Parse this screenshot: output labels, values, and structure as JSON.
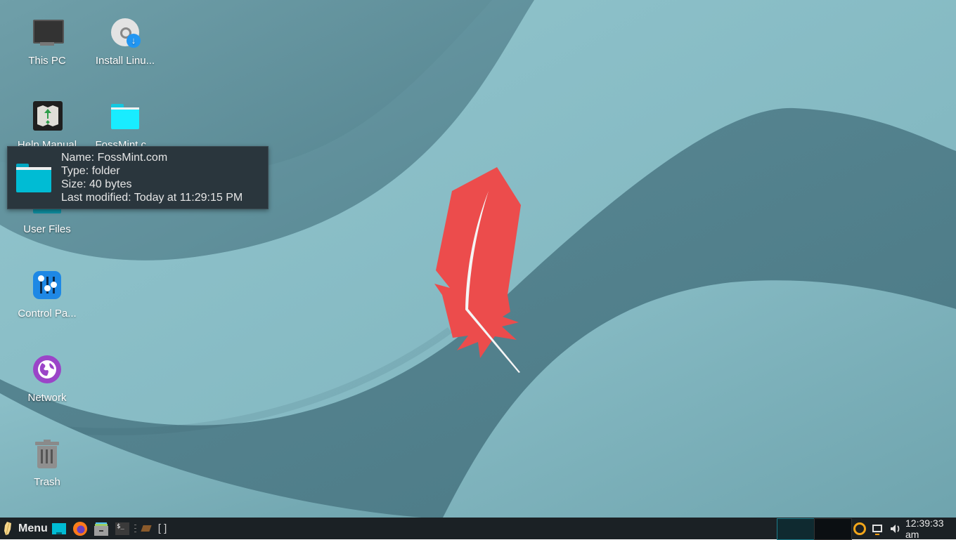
{
  "desktop": {
    "icons": [
      {
        "label": "This PC",
        "icon": "computer-icon"
      },
      {
        "label": "Install Linu...",
        "icon": "install-disc-icon"
      },
      {
        "label": "Help Manual",
        "icon": "help-manual-icon"
      },
      {
        "label": "FossMint.c...",
        "icon": "folder-icon"
      },
      {
        "label": "User Files",
        "icon": "home-folder-icon"
      },
      {
        "label": "Control Pa...",
        "icon": "control-panel-icon"
      },
      {
        "label": "Network",
        "icon": "network-globe-icon"
      },
      {
        "label": "Trash",
        "icon": "trash-icon"
      }
    ],
    "tooltip": {
      "name": "Name: FossMint.com",
      "type": "Type: folder",
      "size": "Size: 40 bytes",
      "modified": "Last modified: Today at 11:29:15 PM"
    },
    "wallpaper_logo": "feather-logo",
    "colors": {
      "feather": "#ec4c4c",
      "wallpaper_light": "#8cc2cb",
      "wallpaper_dark": "#5a8894"
    }
  },
  "taskbar": {
    "menu_label": "Menu",
    "launchers": [
      "show-desktop-icon",
      "firefox-icon",
      "file-manager-icon",
      "terminal-icon"
    ],
    "window_list_text": "[ ]",
    "workspaces": [
      "Workspace 1",
      "Workspace 2"
    ],
    "tray": [
      "update-manager-icon",
      "display-icon",
      "volume-icon"
    ],
    "clock": "12:39:33 am"
  }
}
